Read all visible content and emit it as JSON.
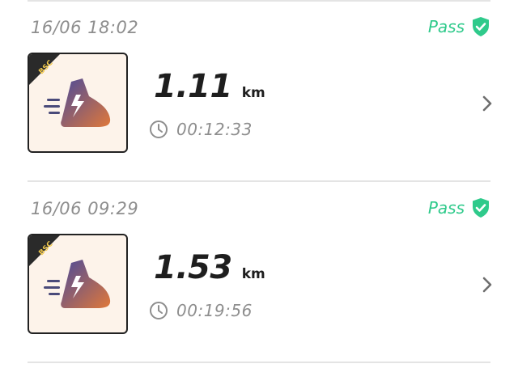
{
  "activities": [
    {
      "timestamp": "16/06 18:02",
      "status": "Pass",
      "badge": "BSC",
      "distance": "1.11",
      "unit": "km",
      "duration": "00:12:33"
    },
    {
      "timestamp": "16/06 09:29",
      "status": "Pass",
      "badge": "BSC",
      "distance": "1.53",
      "unit": "km",
      "duration": "00:19:56"
    }
  ],
  "icons": {
    "status": "shield-check-icon",
    "thumbnail": "running-shoe-icon",
    "duration": "clock-icon",
    "open": "chevron-right-icon"
  },
  "colors": {
    "pass_green": "#2fca8b",
    "muted_text": "#8e8e8e",
    "thumbnail_bg": "#fdf3ea",
    "shoe_gradient_start": "#4a4a9a",
    "shoe_gradient_end": "#e0783a"
  }
}
